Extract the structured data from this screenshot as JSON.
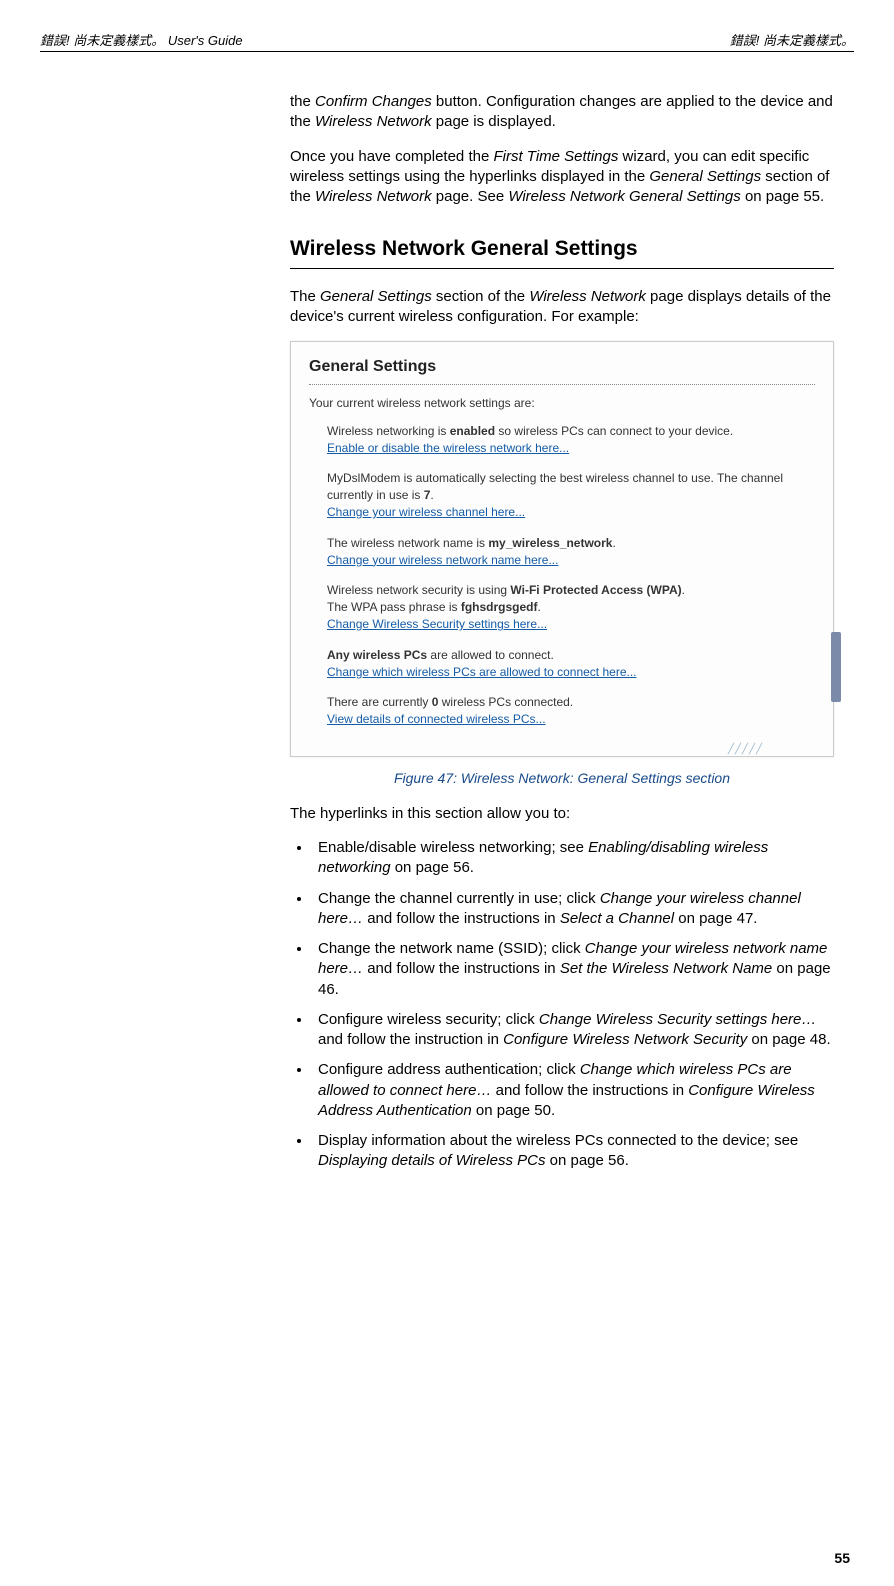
{
  "header": {
    "left": "錯誤! 尚未定義樣式。 User's Guide",
    "right": "錯誤! 尚未定義樣式。"
  },
  "intro_para1_pre": "the ",
  "intro_para1_em1": "Confirm Changes",
  "intro_para1_mid": " button. Configuration changes are applied to the device and the ",
  "intro_para1_em2": "Wireless Network",
  "intro_para1_post": " page is displayed.",
  "intro_para2_pre": "Once you have completed the ",
  "intro_para2_em1": "First Time Settings",
  "intro_para2_mid1": " wizard, you can edit specific wireless settings using the hyperlinks displayed in the ",
  "intro_para2_em2": "General Settings",
  "intro_para2_mid2": " section of the ",
  "intro_para2_em3": "Wireless Network",
  "intro_para2_mid3": " page. See ",
  "intro_para2_em4": "Wireless Network General Settings",
  "intro_para2_post": " on page 55.",
  "section_title": "Wireless Network General Settings",
  "section_intro_pre": "The ",
  "section_intro_em1": "General Settings",
  "section_intro_mid": " section of the ",
  "section_intro_em2": "Wireless Network",
  "section_intro_post": " page displays details of the device's current wireless configuration. For example:",
  "figure": {
    "title": "General Settings",
    "intro": "Your current wireless network settings are:",
    "blocks": [
      {
        "line1_pre": "Wireless networking is ",
        "line1_bold": "enabled",
        "line1_post": " so wireless PCs can connect to your device.",
        "link": "Enable or disable the wireless network here..."
      },
      {
        "line1_pre": "MyDslModem is automatically selecting the best wireless channel to use. The channel currently in use is ",
        "line1_bold": "7",
        "line1_post": ".",
        "link": "Change your wireless channel here..."
      },
      {
        "line1_pre": "The wireless network name is ",
        "line1_bold": "my_wireless_network",
        "line1_post": ".",
        "link": "Change your wireless network name here..."
      },
      {
        "line1_pre": "Wireless network security is using ",
        "line1_bold": "Wi-Fi Protected Access (WPA)",
        "line1_post": ".",
        "line2_pre": "The WPA pass phrase is ",
        "line2_bold": "fghsdrgsgedf",
        "line2_post": ".",
        "link": "Change Wireless Security settings here..."
      },
      {
        "line1_bold_first": "Any wireless PCs",
        "line1_post_first": " are allowed to connect.",
        "link": "Change which wireless PCs are allowed to connect here..."
      },
      {
        "line1_pre": "There are currently ",
        "line1_bold": "0",
        "line1_post": " wireless PCs connected.",
        "link": "View details of connected wireless PCs..."
      }
    ]
  },
  "caption": "Figure 47:       Wireless Network: General Settings section",
  "hyperlinks_intro": "The hyperlinks in this section allow you to:",
  "bullets": [
    {
      "pre": "Enable/disable wireless networking; see ",
      "em1": "Enabling/disabling wireless networking",
      "post": " on page 56."
    },
    {
      "pre": "Change the channel currently in use; click ",
      "em1": "Change your wireless channel here…",
      "mid": " and follow the instructions in ",
      "em2": "Select a Channel",
      "post": " on page 47."
    },
    {
      "pre": "Change the network name (SSID); click ",
      "em1": "Change your wireless network name here…",
      "mid": " and follow the instructions in ",
      "em2": "Set the Wireless Network Name",
      "post": " on page 46."
    },
    {
      "pre": "Configure wireless security; click ",
      "em1": "Change Wireless Security settings here…",
      "mid": " and follow the instruction in ",
      "em2": "Configure Wireless Network Security",
      "post": " on page 48."
    },
    {
      "pre": "Configure address authentication; click ",
      "em1": "Change which wireless PCs are allowed to connect here…",
      "mid": " and follow the instructions in ",
      "em2": "Configure Wireless Address Authentication",
      "post": " on page 50."
    },
    {
      "pre": "Display information about the wireless PCs connected to the device; see ",
      "em1": "Displaying details of Wireless PCs",
      "post": " on page 56."
    }
  ],
  "page_number": "55"
}
